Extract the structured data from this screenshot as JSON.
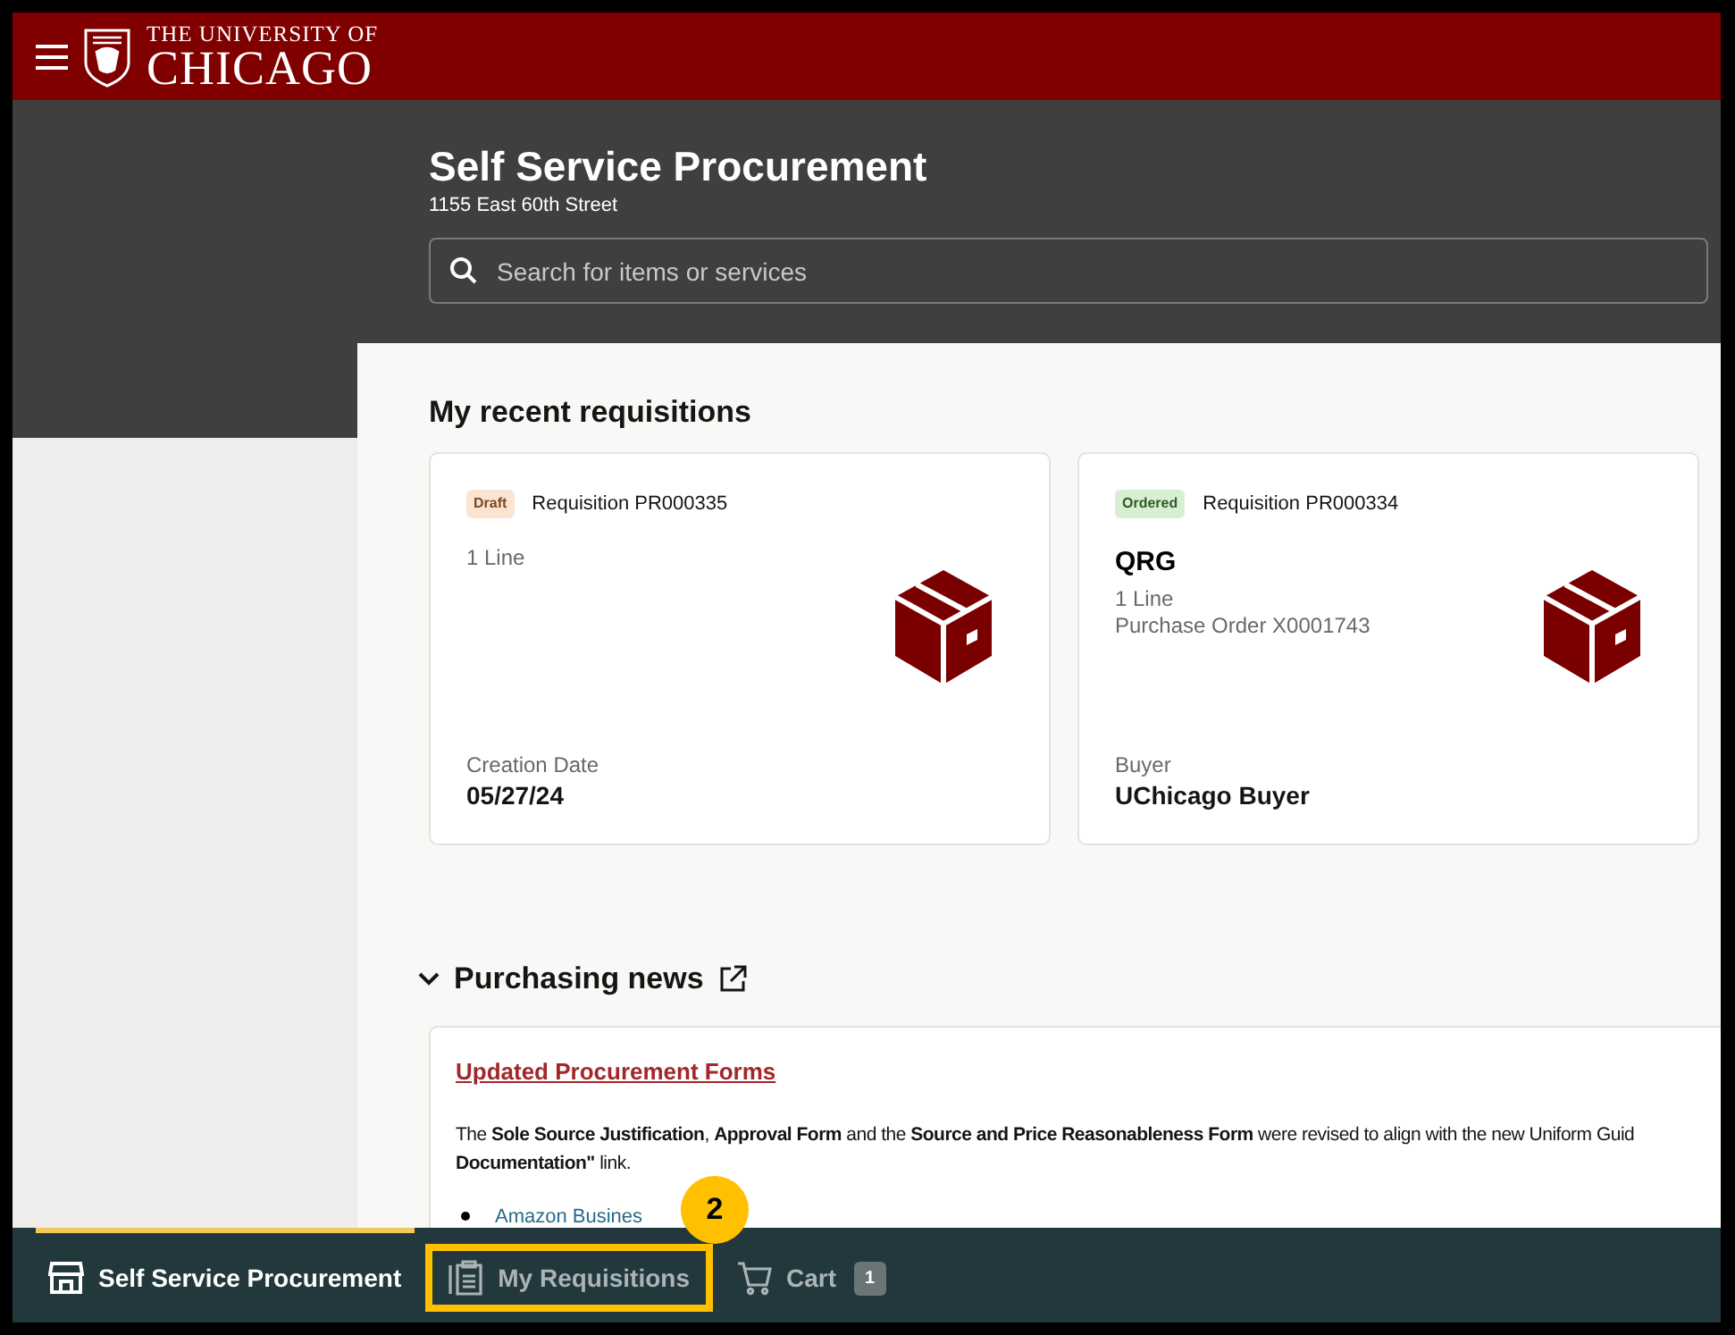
{
  "header": {
    "logo_line_1": "THE UNIVERSITY OF",
    "logo_line_2": "CHICAGO"
  },
  "page": {
    "title": "Self Service Procurement",
    "address": "1155 East 60th Street",
    "search": {
      "placeholder": "Search for items or services"
    }
  },
  "recent": {
    "title": "My recent requisitions",
    "cards": [
      {
        "status": "Draft",
        "kind": "draft",
        "requisition": "Requisition PR000335",
        "lines": [
          "1 Line"
        ],
        "footer_label": "Creation Date",
        "footer_value": "05/27/24"
      },
      {
        "status": "Ordered",
        "kind": "ordered",
        "requisition": "Requisition PR000334",
        "name": "QRG",
        "lines": [
          "1 Line",
          "Purchase Order X0001743"
        ],
        "footer_label": "Buyer",
        "footer_value": "UChicago Buyer"
      }
    ]
  },
  "news": {
    "title": "Purchasing news",
    "expanded": true,
    "items": [
      {
        "headline": "Updated Procurement Forms",
        "text": "The **Sole Source Justification**, **Approval Form** and the **Source and Price Reasonableness Form** were revised to align with the new Uniform Guid\n**Documentation\"** link.",
        "links": [
          "Amazon Busines"
        ]
      }
    ]
  },
  "bottom_nav": [
    {
      "label": "Self Service Procurement",
      "kind": "store",
      "selected": true
    },
    {
      "label": "My Requisitions",
      "kind": "clipboard",
      "selected": false,
      "annotation": "2"
    },
    {
      "label": "Cart",
      "kind": "cart",
      "selected": false,
      "count": "1"
    }
  ]
}
